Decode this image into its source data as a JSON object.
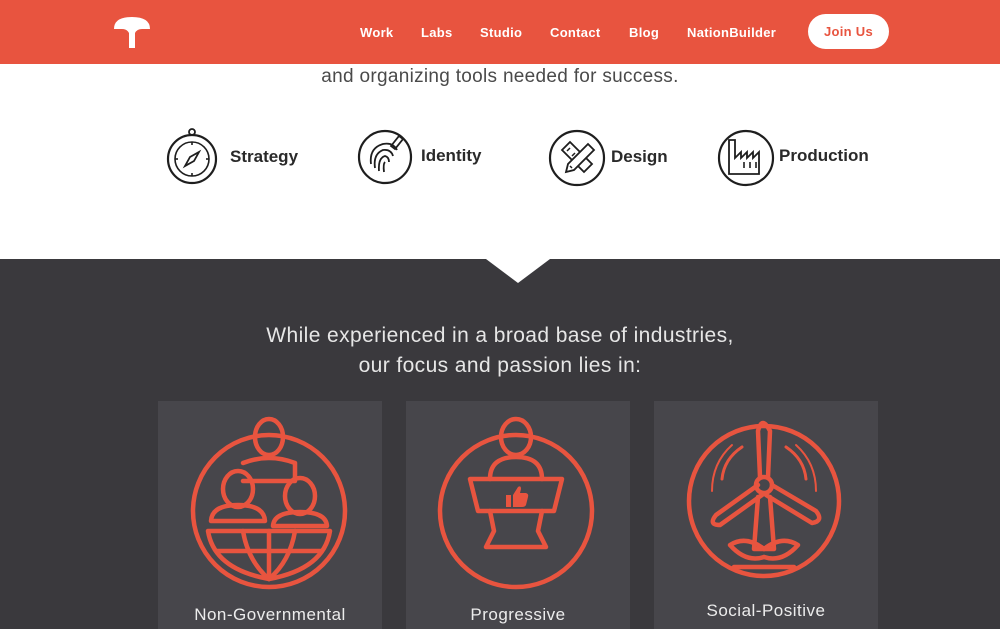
{
  "nav": {
    "links": [
      "Work",
      "Labs",
      "Studio",
      "Contact",
      "Blog",
      "NationBuilder"
    ],
    "join_label": "Join Us"
  },
  "intro": {
    "text": "and organizing tools needed for success."
  },
  "services": [
    {
      "label": "Strategy",
      "icon": "compass-icon"
    },
    {
      "label": "Identity",
      "icon": "fingerprint-icon"
    },
    {
      "label": "Design",
      "icon": "pencil-ruler-icon"
    },
    {
      "label": "Production",
      "icon": "factory-icon"
    }
  ],
  "focus": {
    "line1": "While experienced in a broad base of industries,",
    "line2": "our focus and passion lies in:"
  },
  "cards": [
    {
      "label": "Non-Governmental",
      "icon": "people-globe-icon"
    },
    {
      "label": "Progressive",
      "icon": "podium-speaker-icon"
    },
    {
      "label": "Social-Positive",
      "icon": "wind-turbine-icon"
    }
  ],
  "colors": {
    "brand": "#e8543f",
    "dark_bg": "#3a393d",
    "card_bg": "#47464b"
  }
}
